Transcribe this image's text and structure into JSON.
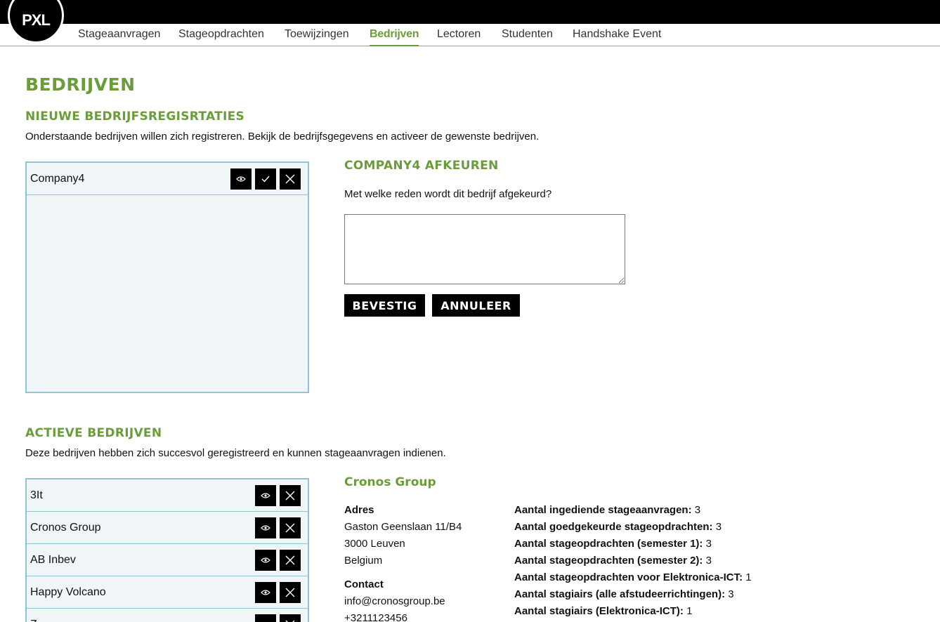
{
  "brand": {
    "logo_text": "PXL"
  },
  "nav": {
    "items": [
      {
        "label": "Stageaanvragen"
      },
      {
        "label": "Stageopdrachten"
      },
      {
        "label": "Toewijzingen"
      },
      {
        "label": "Bedrijven"
      },
      {
        "label": "Lectoren"
      },
      {
        "label": "Studenten"
      },
      {
        "label": "Handshake Event"
      }
    ],
    "active": "Bedrijven"
  },
  "page": {
    "title": "BEDRIJVEN"
  },
  "new_registrations": {
    "heading": "NIEUWE BEDRIJFSREGISRTATIES",
    "description": "Onderstaande bedrijven willen zich registreren. Bekijk de bedrijfsgegevens en activeer de gewenste bedrijven.",
    "companies": [
      {
        "name": "Company4"
      }
    ]
  },
  "reject_panel": {
    "heading": "COMPANY4 AFKEUREN",
    "question": "Met welke reden wordt dit bedrijf afgekeurd?",
    "reason_value": "",
    "confirm_label": "BEVESTIG",
    "cancel_label": "ANNULEER"
  },
  "active_companies": {
    "heading": "ACTIEVE BEDRIJVEN",
    "description": "Deze bedrijven hebben zich succesvol geregistreerd en kunnen stageaanvragen indienen.",
    "companies": [
      {
        "name": "3It"
      },
      {
        "name": "Cronos Group"
      },
      {
        "name": "AB Inbev"
      },
      {
        "name": "Happy Volcano"
      },
      {
        "name": "Z"
      }
    ]
  },
  "company_detail": {
    "name": "Cronos Group",
    "address_label": "Adres",
    "address_lines": [
      "Gaston Geenslaan 11/B4",
      "3000 Leuven",
      "Belgium"
    ],
    "contact_label": "Contact",
    "contact_lines": [
      "info@cronosgroup.be",
      "+3211123456"
    ],
    "stats": [
      {
        "label": "Aantal ingediende stageaanvragen:",
        "value": "3"
      },
      {
        "label": "Aantal goedgekeurde stageopdrachten:",
        "value": "3"
      },
      {
        "label": "Aantal stageopdrachten (semester 1):",
        "value": "3"
      },
      {
        "label": "Aantal stageopdrachten (semester 2):",
        "value": "3"
      },
      {
        "label": "Aantal stageopdrachten voor Elektronica-ICT:",
        "value": "1"
      },
      {
        "label": "Aantal stagiairs (alle afstudeerrichtingen):",
        "value": "3"
      },
      {
        "label": "Aantal stagiairs (Elektronica-ICT):",
        "value": "1"
      }
    ]
  },
  "colors": {
    "accent": "#6a9c3a",
    "list_border": "#8fc3d4",
    "list_bg": "#f0f5f7"
  }
}
